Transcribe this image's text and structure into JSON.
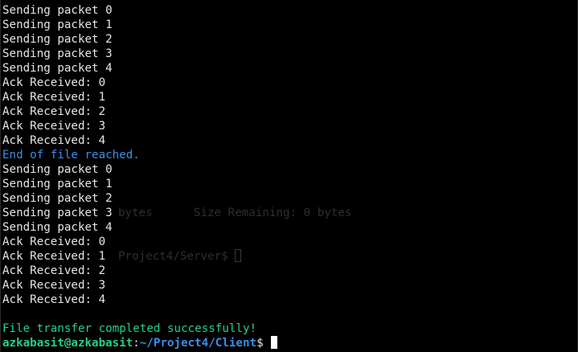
{
  "terminal": {
    "lines": [
      "Sending packet 0",
      "Sending packet 1",
      "Sending packet 2",
      "Sending packet 3",
      "Sending packet 4",
      "Ack Received: 0",
      "Ack Received: 1",
      "Ack Received: 2",
      "Ack Received: 3",
      "Ack Received: 4",
      "End of file reached.",
      "Sending packet 0",
      "Sending packet 1",
      "Sending packet 2",
      "Sending packet 3",
      "Sending packet 4",
      "Ack Received: 0",
      "Ack Received: 1",
      "Ack Received: 2",
      "Ack Received: 3",
      "Ack Received: 4",
      "",
      "File transfer completed successfully!"
    ],
    "ghost": {
      "size_text": "bytes      Size Remaining: 0 bytes",
      "prompt_text": "Project4/Server$"
    },
    "prompt": {
      "user_host": "azkabasit@azkabasit",
      "separator": ":",
      "path": "~/Project4/Client",
      "symbol": "$"
    },
    "colors": {
      "background": "#000000",
      "text": "#e6e6e6",
      "info": "#3b8eea",
      "success": "#23d18b"
    }
  }
}
